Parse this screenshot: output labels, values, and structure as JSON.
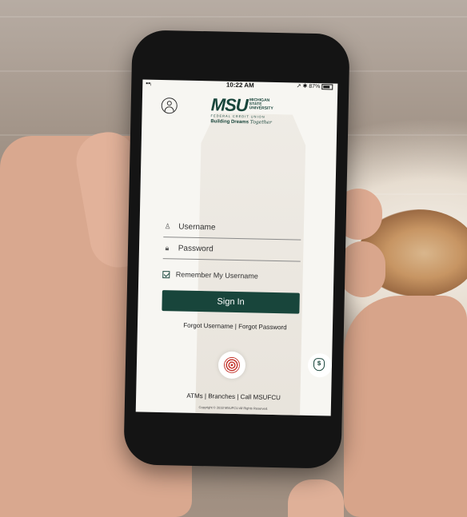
{
  "status_bar": {
    "time": "10:22 AM",
    "battery": "87%",
    "signal": "▪▪ᵢ",
    "right_icons": "↗ ✱"
  },
  "logo": {
    "mark": "MSU",
    "side_text": [
      "MICHIGAN",
      "STATE",
      "UNIVERSITY"
    ],
    "sub_text": "FEDERAL CREDIT UNION",
    "tagline_left": "Building Dreams",
    "tagline_right": "Together"
  },
  "login": {
    "username_placeholder": "Username",
    "password_placeholder": "Password",
    "remember_label": "Remember My Username",
    "sign_in_label": "Sign In",
    "forgot_username": "Forgot Username",
    "forgot_password": "Forgot Password",
    "forgot_separator": "|"
  },
  "links": {
    "atms": "ATMs",
    "branches": "Branches",
    "call": "Call MSUFCU",
    "separator": "|"
  },
  "footer": {
    "copyright": "Copyright © 2018 MSUFCU All Rights Reserved."
  },
  "icons": {
    "profile": "profile-icon",
    "fingerprint": "fingerprint-icon",
    "money": "money-bag-icon",
    "user": "user-icon",
    "lock": "lock-icon",
    "checkbox": "checkbox-icon"
  }
}
